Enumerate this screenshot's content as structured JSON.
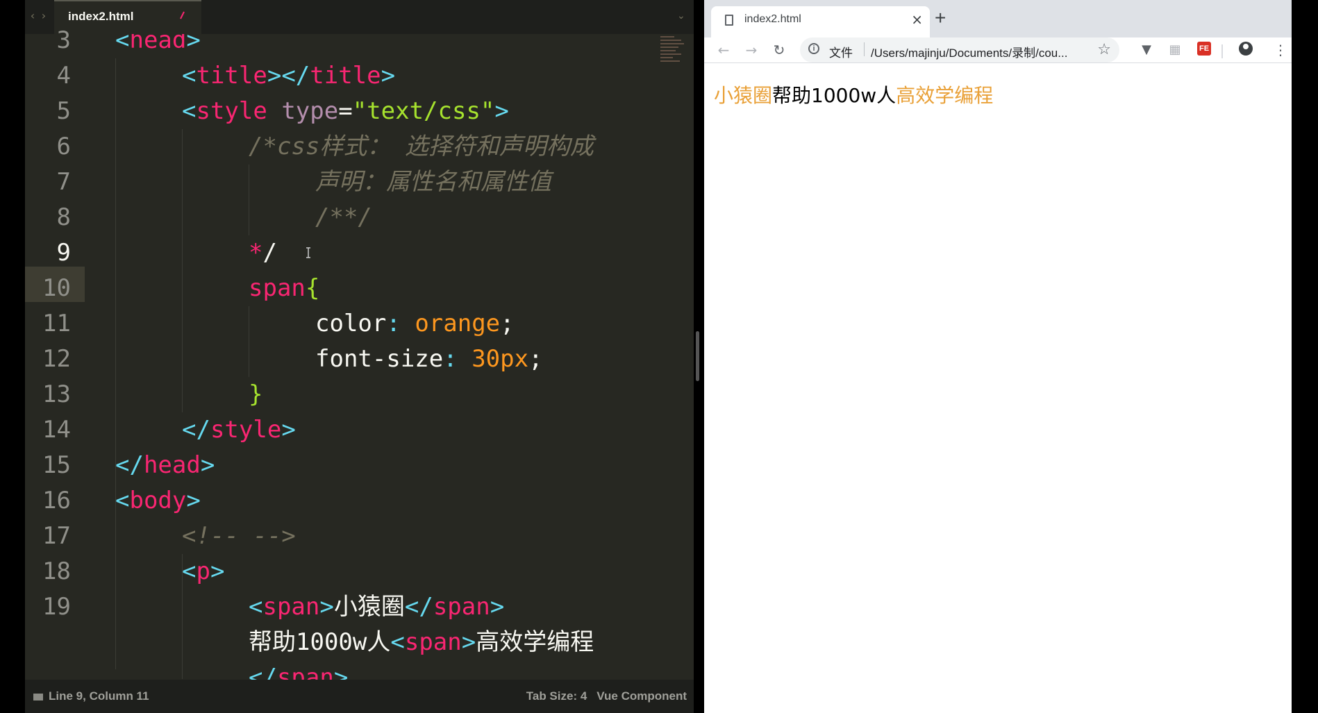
{
  "editor": {
    "tab_title": "index2.html",
    "lines": [
      {
        "n": "3"
      },
      {
        "n": "4"
      },
      {
        "n": "5"
      },
      {
        "n": "6"
      },
      {
        "n": "7"
      },
      {
        "n": "8"
      },
      {
        "n": "9"
      },
      {
        "n": "10"
      },
      {
        "n": "11"
      },
      {
        "n": "12"
      },
      {
        "n": "13"
      },
      {
        "n": "14"
      },
      {
        "n": "15"
      },
      {
        "n": "16"
      },
      {
        "n": "17"
      },
      {
        "n": "18"
      },
      {
        "n": "19"
      }
    ],
    "code": {
      "l3_tag": "head",
      "l4_tag_open": "title",
      "l4_tag_close": "title",
      "l5_tag": "style",
      "l5_attr": "type",
      "l5_value": "\"text/css\"",
      "l6_comment": "/*css样式： 选择符和声明构成",
      "l7_comment": "声明：属性名和属性值",
      "l8_comment": "/**/",
      "l9_comment_end_star": "*",
      "l9_comment_end_slash": "/",
      "l10_selector": "span",
      "l10_brace": "{",
      "l11_prop": "color",
      "l11_value": "orange",
      "l12_prop": "font-size",
      "l12_num": "30",
      "l12_unit": "px",
      "l13_brace": "}",
      "l14_tag": "style",
      "l15_tag": "head",
      "l16_tag": "body",
      "l17_comment": "<!-- -->",
      "l18_tag": "p",
      "l19_span_tag": "span",
      "l19_text": "小猿圈",
      "l19b_text": "帮助1000w人",
      "l19b_span_tag": "span",
      "l19b_text2": "高效学编程",
      "l20_tag": "span"
    },
    "status": {
      "position": "Line 9, Column 11",
      "tab_size": "Tab Size: 4",
      "syntax": "Vue Component"
    },
    "colors": {
      "background": "#272822",
      "tag": "#f92672",
      "bracket": "#66d9ef",
      "attr": "#a6e22e",
      "string": "#e6db74",
      "value": "#fd971f",
      "number": "#ae81ff",
      "comment": "#75715e"
    }
  },
  "browser": {
    "tab_title": "index2.html",
    "omnibox_scheme": "文件",
    "url": "/Users/majinju/Documents/录制/cou...",
    "ext_label": "FE",
    "page": {
      "span1": "小猿圈",
      "text": "帮助1000w人",
      "span2": "高效学编程",
      "span_color": "#e9a037"
    }
  }
}
